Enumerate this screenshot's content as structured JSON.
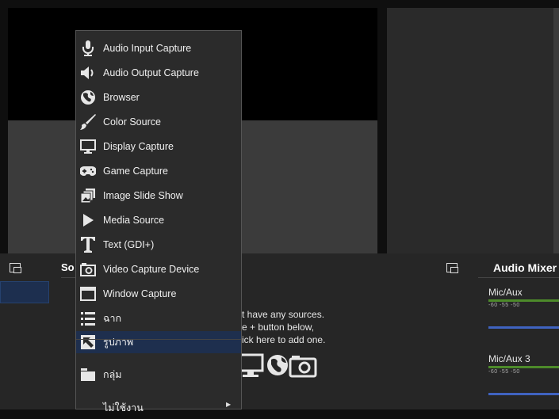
{
  "menu": {
    "items": [
      {
        "label": "Audio Input Capture",
        "icon": "microphone-icon"
      },
      {
        "label": "Audio Output Capture",
        "icon": "speaker-icon"
      },
      {
        "label": "Browser",
        "icon": "globe-icon"
      },
      {
        "label": "Color Source",
        "icon": "brush-icon"
      },
      {
        "label": "Display Capture",
        "icon": "monitor-icon"
      },
      {
        "label": "Game Capture",
        "icon": "gamepad-icon"
      },
      {
        "label": "Image Slide Show",
        "icon": "slideshow-icon"
      },
      {
        "label": "Media Source",
        "icon": "play-icon"
      },
      {
        "label": "Text (GDI+)",
        "icon": "text-icon"
      },
      {
        "label": "Video Capture Device",
        "icon": "camera-icon"
      },
      {
        "label": "Window Capture",
        "icon": "window-icon"
      },
      {
        "label": "ฉาก",
        "icon": "list-icon"
      },
      {
        "label": "รูปภาพ",
        "icon": "image-icon",
        "selected": true
      },
      {
        "label": "กลุ่ม",
        "icon": "folder-icon"
      },
      {
        "label": "ไม่ใช้งาน",
        "icon": "",
        "has_submenu": true
      }
    ]
  },
  "sources": {
    "title": "So",
    "empty_lines": [
      "t have any sources.",
      "e + button below,",
      "ick here to add one."
    ]
  },
  "mixer": {
    "title": "Audio Mixer",
    "tracks": [
      {
        "name": "Mic/Aux",
        "scale": "-60  -55  -50"
      },
      {
        "name": "Mic/Aux 3",
        "scale": "-60  -55  -50"
      }
    ]
  }
}
